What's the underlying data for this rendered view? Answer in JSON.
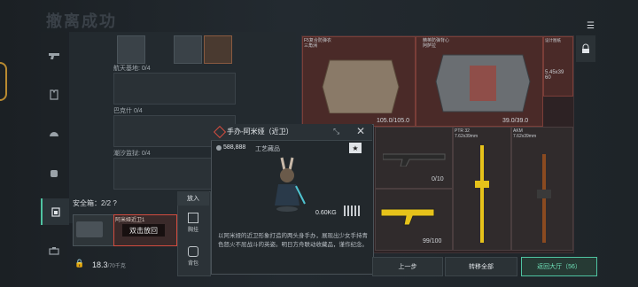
{
  "header": {
    "title": "撤离成功",
    "menu_icon": "menu-icon"
  },
  "nav": {
    "items": [
      {
        "icon": "pistol-icon"
      },
      {
        "icon": "armor-icon"
      },
      {
        "icon": "helmet-icon"
      },
      {
        "icon": "backpack-icon"
      },
      {
        "icon": "container-icon"
      },
      {
        "icon": "briefcase-icon"
      }
    ]
  },
  "collections": [
    {
      "label": "航天基地: 0/4"
    },
    {
      "label": "巴克什 0/4"
    },
    {
      "label": "潮汐监狱: 0/4"
    }
  ],
  "secure_box": {
    "label": "安全箱：2/2",
    "help": "?",
    "item_label": "阿米娅近卫1",
    "double_click_hint": "双击放回",
    "weight": "18.3",
    "weight_cap": "/70千克"
  },
  "put_in": {
    "header": "放入",
    "chest": "胸挂",
    "backpack": "背包"
  },
  "inventory": {
    "cards": [
      {
        "label": "F5复合防弹衣\n三角洲",
        "value": "105.0/105.0"
      },
      {
        "label": "精英防弹背心\n阿萨拉",
        "value": "39.0/39.0"
      },
      {
        "label": "设计图纸",
        "value": "5.45x39\n60"
      },
      {
        "label": "",
        "value": "0/10"
      },
      {
        "label": "PTR 32\n7.62x39mm",
        "value": "99/100"
      },
      {
        "label": "AKM\n7.62x39mm",
        "value": ""
      }
    ]
  },
  "tooltip": {
    "title": "手办-阿米娅（近卫）",
    "price": "588,888",
    "category": "工艺藏品",
    "star": "★",
    "weight": "0.60KG",
    "description": "以阿米娅的近卫形象打造的两头身手办，展现出少女手持青色怒火不屈战斗的英姿。明日方舟联动收藏品，谨作纪念。"
  },
  "bottom": {
    "prev": "上一步",
    "transfer_all": "转移全部",
    "return_lobby": "返回大厅（56）"
  },
  "colors": {
    "accent": "#4fc3a1",
    "danger": "#d14c3f",
    "gold": "#c69a3a"
  }
}
